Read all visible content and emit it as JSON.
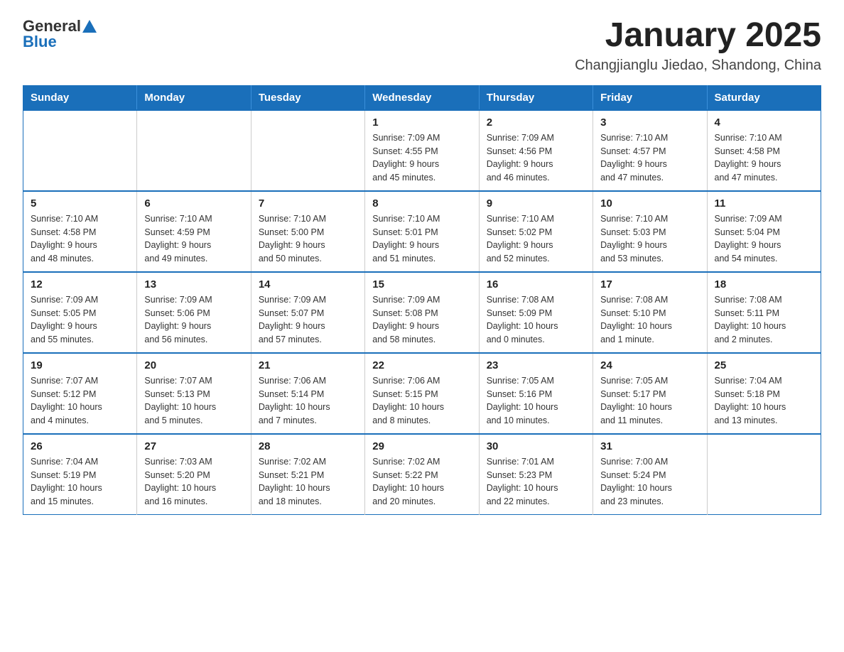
{
  "header": {
    "logo_general": "General",
    "logo_blue": "Blue",
    "month_title": "January 2025",
    "location": "Changjianglu Jiedao, Shandong, China"
  },
  "weekdays": [
    "Sunday",
    "Monday",
    "Tuesday",
    "Wednesday",
    "Thursday",
    "Friday",
    "Saturday"
  ],
  "weeks": [
    [
      {
        "day": "",
        "info": ""
      },
      {
        "day": "",
        "info": ""
      },
      {
        "day": "",
        "info": ""
      },
      {
        "day": "1",
        "info": "Sunrise: 7:09 AM\nSunset: 4:55 PM\nDaylight: 9 hours\nand 45 minutes."
      },
      {
        "day": "2",
        "info": "Sunrise: 7:09 AM\nSunset: 4:56 PM\nDaylight: 9 hours\nand 46 minutes."
      },
      {
        "day": "3",
        "info": "Sunrise: 7:10 AM\nSunset: 4:57 PM\nDaylight: 9 hours\nand 47 minutes."
      },
      {
        "day": "4",
        "info": "Sunrise: 7:10 AM\nSunset: 4:58 PM\nDaylight: 9 hours\nand 47 minutes."
      }
    ],
    [
      {
        "day": "5",
        "info": "Sunrise: 7:10 AM\nSunset: 4:58 PM\nDaylight: 9 hours\nand 48 minutes."
      },
      {
        "day": "6",
        "info": "Sunrise: 7:10 AM\nSunset: 4:59 PM\nDaylight: 9 hours\nand 49 minutes."
      },
      {
        "day": "7",
        "info": "Sunrise: 7:10 AM\nSunset: 5:00 PM\nDaylight: 9 hours\nand 50 minutes."
      },
      {
        "day": "8",
        "info": "Sunrise: 7:10 AM\nSunset: 5:01 PM\nDaylight: 9 hours\nand 51 minutes."
      },
      {
        "day": "9",
        "info": "Sunrise: 7:10 AM\nSunset: 5:02 PM\nDaylight: 9 hours\nand 52 minutes."
      },
      {
        "day": "10",
        "info": "Sunrise: 7:10 AM\nSunset: 5:03 PM\nDaylight: 9 hours\nand 53 minutes."
      },
      {
        "day": "11",
        "info": "Sunrise: 7:09 AM\nSunset: 5:04 PM\nDaylight: 9 hours\nand 54 minutes."
      }
    ],
    [
      {
        "day": "12",
        "info": "Sunrise: 7:09 AM\nSunset: 5:05 PM\nDaylight: 9 hours\nand 55 minutes."
      },
      {
        "day": "13",
        "info": "Sunrise: 7:09 AM\nSunset: 5:06 PM\nDaylight: 9 hours\nand 56 minutes."
      },
      {
        "day": "14",
        "info": "Sunrise: 7:09 AM\nSunset: 5:07 PM\nDaylight: 9 hours\nand 57 minutes."
      },
      {
        "day": "15",
        "info": "Sunrise: 7:09 AM\nSunset: 5:08 PM\nDaylight: 9 hours\nand 58 minutes."
      },
      {
        "day": "16",
        "info": "Sunrise: 7:08 AM\nSunset: 5:09 PM\nDaylight: 10 hours\nand 0 minutes."
      },
      {
        "day": "17",
        "info": "Sunrise: 7:08 AM\nSunset: 5:10 PM\nDaylight: 10 hours\nand 1 minute."
      },
      {
        "day": "18",
        "info": "Sunrise: 7:08 AM\nSunset: 5:11 PM\nDaylight: 10 hours\nand 2 minutes."
      }
    ],
    [
      {
        "day": "19",
        "info": "Sunrise: 7:07 AM\nSunset: 5:12 PM\nDaylight: 10 hours\nand 4 minutes."
      },
      {
        "day": "20",
        "info": "Sunrise: 7:07 AM\nSunset: 5:13 PM\nDaylight: 10 hours\nand 5 minutes."
      },
      {
        "day": "21",
        "info": "Sunrise: 7:06 AM\nSunset: 5:14 PM\nDaylight: 10 hours\nand 7 minutes."
      },
      {
        "day": "22",
        "info": "Sunrise: 7:06 AM\nSunset: 5:15 PM\nDaylight: 10 hours\nand 8 minutes."
      },
      {
        "day": "23",
        "info": "Sunrise: 7:05 AM\nSunset: 5:16 PM\nDaylight: 10 hours\nand 10 minutes."
      },
      {
        "day": "24",
        "info": "Sunrise: 7:05 AM\nSunset: 5:17 PM\nDaylight: 10 hours\nand 11 minutes."
      },
      {
        "day": "25",
        "info": "Sunrise: 7:04 AM\nSunset: 5:18 PM\nDaylight: 10 hours\nand 13 minutes."
      }
    ],
    [
      {
        "day": "26",
        "info": "Sunrise: 7:04 AM\nSunset: 5:19 PM\nDaylight: 10 hours\nand 15 minutes."
      },
      {
        "day": "27",
        "info": "Sunrise: 7:03 AM\nSunset: 5:20 PM\nDaylight: 10 hours\nand 16 minutes."
      },
      {
        "day": "28",
        "info": "Sunrise: 7:02 AM\nSunset: 5:21 PM\nDaylight: 10 hours\nand 18 minutes."
      },
      {
        "day": "29",
        "info": "Sunrise: 7:02 AM\nSunset: 5:22 PM\nDaylight: 10 hours\nand 20 minutes."
      },
      {
        "day": "30",
        "info": "Sunrise: 7:01 AM\nSunset: 5:23 PM\nDaylight: 10 hours\nand 22 minutes."
      },
      {
        "day": "31",
        "info": "Sunrise: 7:00 AM\nSunset: 5:24 PM\nDaylight: 10 hours\nand 23 minutes."
      },
      {
        "day": "",
        "info": ""
      }
    ]
  ]
}
